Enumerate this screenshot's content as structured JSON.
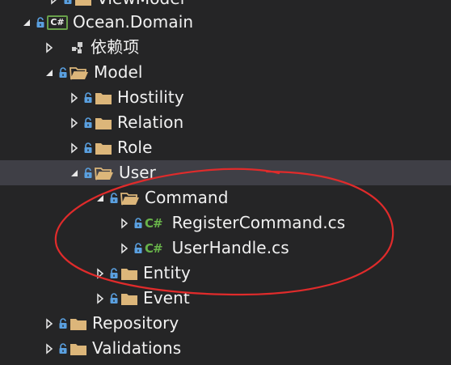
{
  "solution_explorer": {
    "items": [
      {
        "label": "ViewModel",
        "icon": "folder-icon",
        "state": "collapsed",
        "depth": 1
      },
      {
        "label": "Ocean.Domain",
        "icon": "csharp-project-icon",
        "state": "expanded",
        "depth": 0
      },
      {
        "label": "依赖项",
        "icon": "dependencies-icon",
        "state": "collapsed",
        "depth": 1
      },
      {
        "label": "Model",
        "icon": "folder-open-icon",
        "state": "expanded",
        "depth": 1
      },
      {
        "label": "Hostility",
        "icon": "folder-icon",
        "state": "collapsed",
        "depth": 2
      },
      {
        "label": "Relation",
        "icon": "folder-icon",
        "state": "collapsed",
        "depth": 2
      },
      {
        "label": "Role",
        "icon": "folder-icon",
        "state": "collapsed",
        "depth": 2
      },
      {
        "label": "User",
        "icon": "folder-open-icon",
        "state": "expanded",
        "depth": 2,
        "selected": true
      },
      {
        "label": "Command",
        "icon": "folder-open-icon",
        "state": "expanded",
        "depth": 3
      },
      {
        "label": "RegisterCommand.cs",
        "icon": "csharp-file-icon",
        "state": "collapsed",
        "depth": 4
      },
      {
        "label": "UserHandle.cs",
        "icon": "csharp-file-icon",
        "state": "collapsed",
        "depth": 4
      },
      {
        "label": "Entity",
        "icon": "folder-icon",
        "state": "collapsed",
        "depth": 3
      },
      {
        "label": "Event",
        "icon": "folder-icon",
        "state": "collapsed",
        "depth": 3
      },
      {
        "label": "Repository",
        "icon": "folder-icon",
        "state": "collapsed",
        "depth": 1
      },
      {
        "label": "Validations",
        "icon": "folder-icon",
        "state": "collapsed",
        "depth": 1
      }
    ],
    "csharp_badge": "C#"
  },
  "colors": {
    "background": "#252526",
    "selected_row": "#3f3f46",
    "text": "#f1f1f1",
    "folder": "#dcb67a",
    "lock": "#5aa0e0",
    "csharp_green": "#68b34a",
    "annotation_circle": "#e02b2b"
  }
}
